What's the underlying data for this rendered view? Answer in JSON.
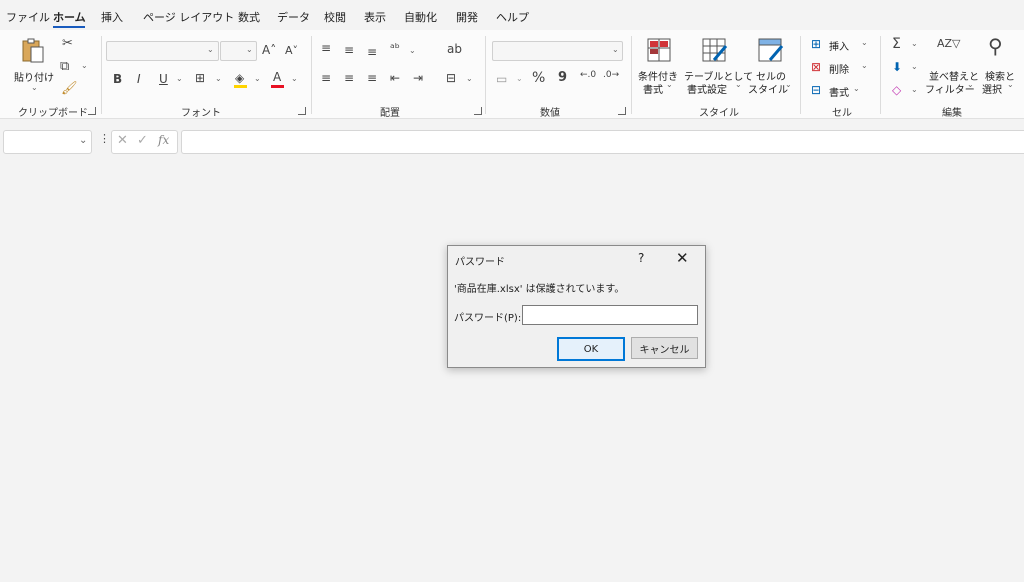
{
  "menu_tabs": [
    "ファイル",
    "ホーム",
    "挿入",
    "ページ レイアウト",
    "数式",
    "データ",
    "校閲",
    "表示",
    "自動化",
    "開発",
    "ヘルプ"
  ],
  "ribbon": {
    "clipboard": {
      "paste_label": "貼り付け",
      "group": "クリップボード"
    },
    "font": {
      "group": "フォント",
      "bold": "B",
      "italic": "I",
      "underline": "U"
    },
    "alignment": {
      "group": "配置"
    },
    "number": {
      "group": "数値",
      "percent": "%",
      "comma": "9"
    },
    "styles": {
      "group": "スタイル",
      "conditional_format": "条件付き\n書式",
      "cond1": "条件付き",
      "cond2": "書式",
      "format_table1": "テーブルとして",
      "format_table2": "書式設定",
      "cell_styles1": "セルの",
      "cell_styles2": "スタイル"
    },
    "cells": {
      "group": "セル",
      "insert": "挿入",
      "delete": "削除",
      "format": "書式"
    },
    "editing": {
      "group": "編集",
      "sort1": "並べ替えと",
      "sort2": "フィルター",
      "find1": "検索と",
      "find2": "選択"
    }
  },
  "formula_bar": {
    "fx": "fx"
  },
  "dialog": {
    "title": "パスワード",
    "help": "?",
    "close": "✕",
    "message": "'商品在庫.xlsx' は保護されています。",
    "label": "パスワード(P):",
    "ok": "OK",
    "cancel": "キャンセル"
  }
}
